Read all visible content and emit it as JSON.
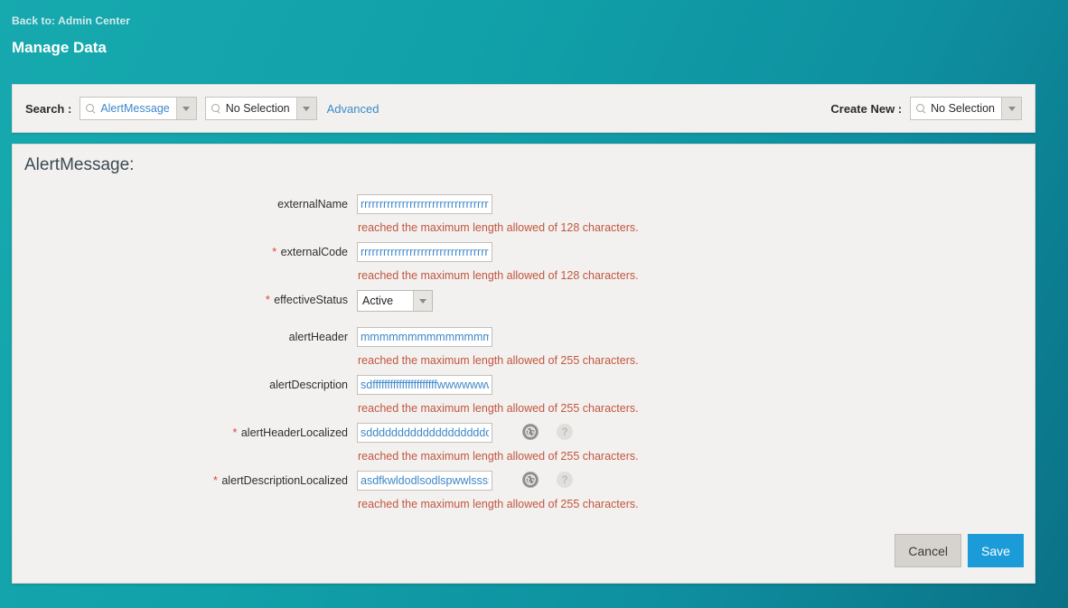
{
  "header": {
    "back_link": "Back to: Admin Center",
    "title": "Manage Data"
  },
  "searchbar": {
    "search_label": "Search :",
    "entity_value": "AlertMessage",
    "selection_value": "No Selection",
    "advanced_label": "Advanced",
    "create_label": "Create New :",
    "create_value": "No Selection",
    "search_icon": "search-icon",
    "chevron_icon": "chevron-down-icon"
  },
  "panel": {
    "title": "AlertMessage:",
    "fields": [
      {
        "label": "externalName",
        "required": false,
        "type": "text",
        "value": "rrrrrrrrrrrrrrrrrrrrrrrrrrrrrrrrrrrr",
        "error": "reached the maximum length allowed of 128 characters.",
        "has_icons": false
      },
      {
        "label": "externalCode",
        "required": true,
        "type": "text",
        "value": "rrrrrrrrrrrrrrrrrrrrrrrrrrrrrrrrrrrr",
        "error": "reached the maximum length allowed of 128 characters.",
        "has_icons": false
      },
      {
        "label": "effectiveStatus",
        "required": true,
        "type": "select",
        "value": "Active",
        "error": "",
        "has_icons": false
      },
      {
        "label": "alertHeader",
        "required": false,
        "type": "text",
        "value": "mmmmmmmmmmmmmmmm",
        "error": "reached the maximum length allowed of 255 characters.",
        "has_icons": false
      },
      {
        "label": "alertDescription",
        "required": false,
        "type": "text",
        "value": "sdffffffffffffffffffffffwwwwwww",
        "error": "reached the maximum length allowed of 255 characters.",
        "has_icons": false
      },
      {
        "label": "alertHeaderLocalized",
        "required": true,
        "type": "text",
        "value": "sddddddddddddddddddddd",
        "error": "reached the maximum length allowed of 255 characters.",
        "has_icons": true
      },
      {
        "label": "alertDescriptionLocalized",
        "required": true,
        "type": "text",
        "value": "asdfkwldodlsodlspwwlsssss",
        "error": "reached the maximum length allowed of 255 characters.",
        "has_icons": true
      }
    ],
    "globe_icon": "globe-icon",
    "help_icon": "help-icon",
    "required_marker": "*"
  },
  "footer": {
    "cancel_label": "Cancel",
    "save_label": "Save"
  },
  "colors": {
    "teal": "#11a2a9",
    "teal_dark": "#0b7186",
    "panel_bg": "#f2f1ef",
    "save_blue": "#1b9cd9",
    "error_red": "#c2563f",
    "input_text_blue": "#3e87c8",
    "required_red": "#d9443f",
    "link_blue": "#3b8bc9"
  }
}
